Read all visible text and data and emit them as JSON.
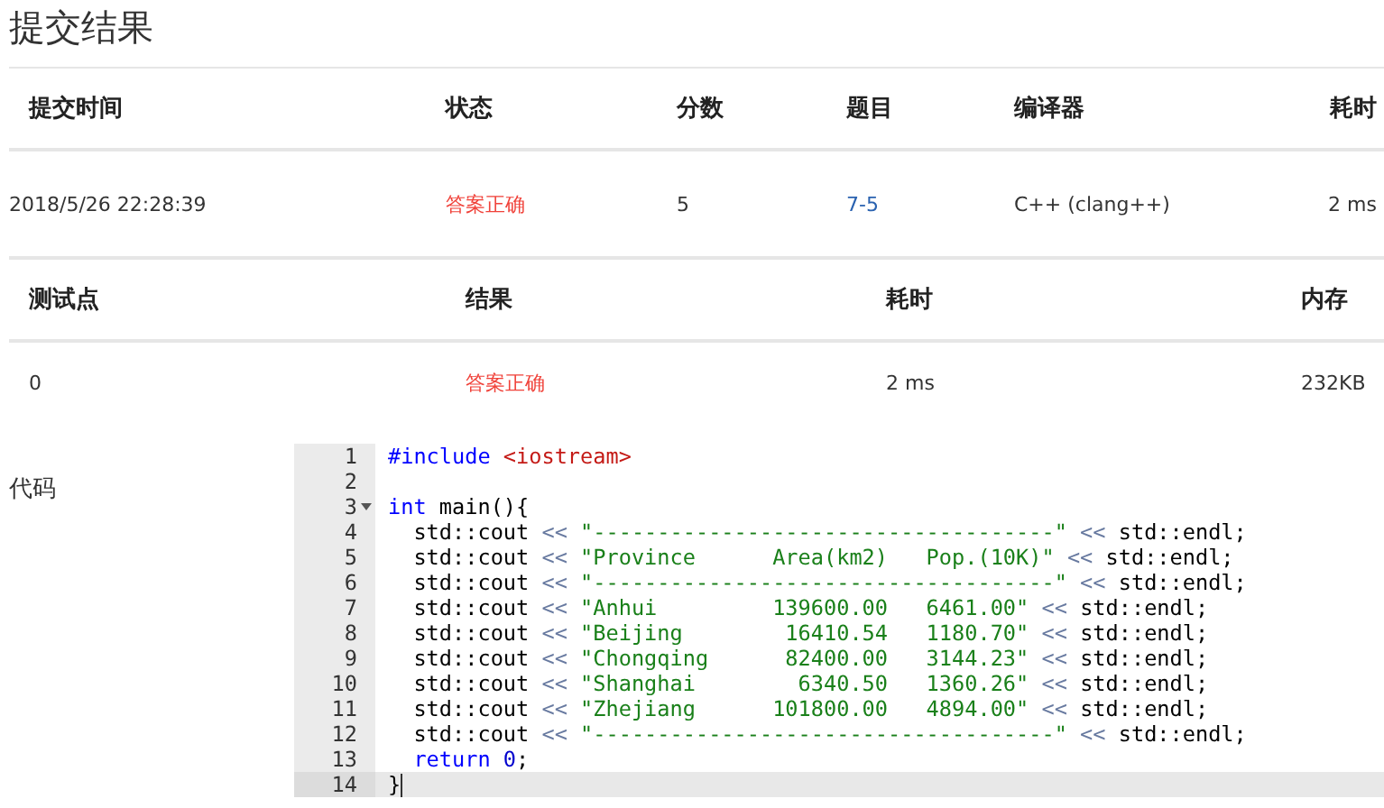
{
  "title": "提交结果",
  "submission_table": {
    "columns": [
      "提交时间",
      "状态",
      "分数",
      "题目",
      "编译器",
      "耗时"
    ],
    "rows": [
      {
        "cells": [
          {
            "kind": "plain",
            "text": "2018/5/26 22:28:39"
          },
          {
            "kind": "status",
            "text": "答案正确"
          },
          {
            "kind": "plain",
            "text": "5"
          },
          {
            "kind": "link",
            "text": "7-5"
          },
          {
            "kind": "plain",
            "text": "C++ (clang++)"
          },
          {
            "kind": "plain",
            "text": "2 ms"
          }
        ]
      }
    ]
  },
  "test_table": {
    "columns": [
      "测试点",
      "结果",
      "耗时",
      "内存"
    ],
    "rows": [
      {
        "cells": [
          {
            "kind": "plain",
            "text": "0"
          },
          {
            "kind": "status",
            "text": "答案正确"
          },
          {
            "kind": "plain",
            "text": "2 ms"
          },
          {
            "kind": "plain",
            "text": "232KB"
          }
        ]
      }
    ]
  },
  "code": {
    "label": "代码",
    "lines": [
      {
        "number": "1",
        "foldable": false,
        "active": false,
        "tokens": [
          {
            "kind": "keyword",
            "text": "#include "
          },
          {
            "kind": "include",
            "text": "<iostream>"
          }
        ]
      },
      {
        "number": "2",
        "foldable": false,
        "active": false
      },
      {
        "number": "3",
        "foldable": true,
        "active": false,
        "tokens": [
          {
            "kind": "keyword",
            "text": "int"
          },
          {
            "kind": "plain",
            "text": " main(){"
          }
        ]
      },
      {
        "number": "4",
        "foldable": false,
        "active": false,
        "tokens": [
          {
            "kind": "plain",
            "text": "  std::cout "
          },
          {
            "kind": "operator",
            "text": "<< "
          },
          {
            "kind": "string",
            "text": "\"------------------------------------\""
          },
          {
            "kind": "operator",
            "text": " << "
          },
          {
            "kind": "plain",
            "text": "std::endl;"
          }
        ]
      },
      {
        "number": "5",
        "foldable": false,
        "active": false,
        "tokens": [
          {
            "kind": "plain",
            "text": "  std::cout "
          },
          {
            "kind": "operator",
            "text": "<< "
          },
          {
            "kind": "string",
            "text": "\"Province      Area(km2)   Pop.(10K)\""
          },
          {
            "kind": "operator",
            "text": " << "
          },
          {
            "kind": "plain",
            "text": "std::endl;"
          }
        ]
      },
      {
        "number": "6",
        "foldable": false,
        "active": false,
        "tokens": [
          {
            "kind": "plain",
            "text": "  std::cout "
          },
          {
            "kind": "operator",
            "text": "<< "
          },
          {
            "kind": "string",
            "text": "\"------------------------------------\""
          },
          {
            "kind": "operator",
            "text": " << "
          },
          {
            "kind": "plain",
            "text": "std::endl;"
          }
        ]
      },
      {
        "number": "7",
        "foldable": false,
        "active": false,
        "tokens": [
          {
            "kind": "plain",
            "text": "  std::cout "
          },
          {
            "kind": "operator",
            "text": "<< "
          },
          {
            "kind": "string",
            "text": "\"Anhui         139600.00   6461.00\""
          },
          {
            "kind": "operator",
            "text": " << "
          },
          {
            "kind": "plain",
            "text": "std::endl;"
          }
        ]
      },
      {
        "number": "8",
        "foldable": false,
        "active": false,
        "tokens": [
          {
            "kind": "plain",
            "text": "  std::cout "
          },
          {
            "kind": "operator",
            "text": "<< "
          },
          {
            "kind": "string",
            "text": "\"Beijing        16410.54   1180.70\""
          },
          {
            "kind": "operator",
            "text": " << "
          },
          {
            "kind": "plain",
            "text": "std::endl;"
          }
        ]
      },
      {
        "number": "9",
        "foldable": false,
        "active": false,
        "tokens": [
          {
            "kind": "plain",
            "text": "  std::cout "
          },
          {
            "kind": "operator",
            "text": "<< "
          },
          {
            "kind": "string",
            "text": "\"Chongqing      82400.00   3144.23\""
          },
          {
            "kind": "operator",
            "text": " << "
          },
          {
            "kind": "plain",
            "text": "std::endl;"
          }
        ]
      },
      {
        "number": "10",
        "foldable": false,
        "active": false,
        "tokens": [
          {
            "kind": "plain",
            "text": "  std::cout "
          },
          {
            "kind": "operator",
            "text": "<< "
          },
          {
            "kind": "string",
            "text": "\"Shanghai        6340.50   1360.26\""
          },
          {
            "kind": "operator",
            "text": " << "
          },
          {
            "kind": "plain",
            "text": "std::endl;"
          }
        ]
      },
      {
        "number": "11",
        "foldable": false,
        "active": false,
        "tokens": [
          {
            "kind": "plain",
            "text": "  std::cout "
          },
          {
            "kind": "operator",
            "text": "<< "
          },
          {
            "kind": "string",
            "text": "\"Zhejiang      101800.00   4894.00\""
          },
          {
            "kind": "operator",
            "text": " << "
          },
          {
            "kind": "plain",
            "text": "std::endl;"
          }
        ]
      },
      {
        "number": "12",
        "foldable": false,
        "active": false,
        "tokens": [
          {
            "kind": "plain",
            "text": "  std::cout "
          },
          {
            "kind": "operator",
            "text": "<< "
          },
          {
            "kind": "string",
            "text": "\"------------------------------------\""
          },
          {
            "kind": "operator",
            "text": " << "
          },
          {
            "kind": "plain",
            "text": "std::endl;"
          }
        ]
      },
      {
        "number": "13",
        "foldable": false,
        "active": false,
        "tokens": [
          {
            "kind": "keyword",
            "text": "  return "
          },
          {
            "kind": "number",
            "text": "0"
          },
          {
            "kind": "plain",
            "text": ";"
          }
        ]
      },
      {
        "number": "14",
        "foldable": false,
        "active": true,
        "tokens": [
          {
            "kind": "plain",
            "text": "}"
          }
        ]
      }
    ]
  }
}
